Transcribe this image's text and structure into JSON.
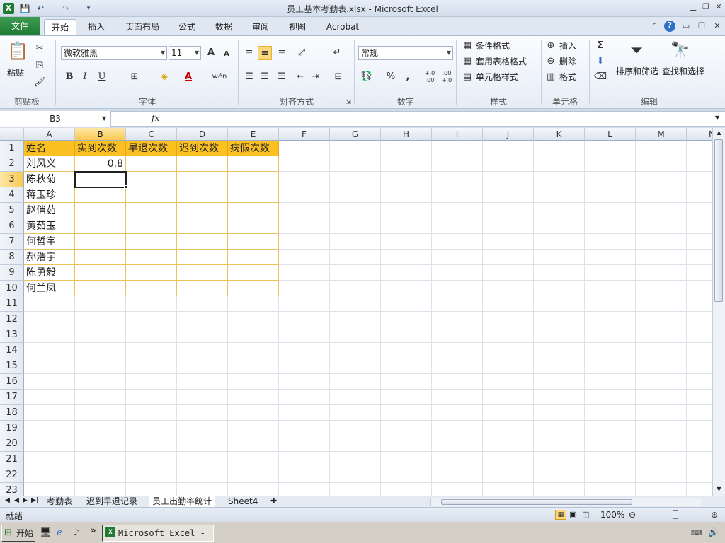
{
  "window": {
    "title": "员工基本考勤表.xlsx  -  Microsoft Excel",
    "app_icon": "X",
    "quick_access": [
      "save-icon",
      "undo-icon",
      "redo-icon",
      "customize-icon"
    ]
  },
  "tabs": {
    "file": "文件",
    "items": [
      "开始",
      "插入",
      "页面布局",
      "公式",
      "数据",
      "审阅",
      "视图",
      "Acrobat"
    ],
    "active": "开始"
  },
  "ribbon": {
    "clipboard": {
      "label": "剪贴板",
      "paste": "粘贴"
    },
    "font": {
      "label": "字体",
      "family": "微软雅黑",
      "size": "11",
      "bold": "B",
      "italic": "I",
      "underline": "U",
      "grow": "A",
      "shrink": "A",
      "font_color_letter": "A",
      "wen": "wén"
    },
    "align": {
      "label": "对齐方式"
    },
    "number": {
      "label": "数字",
      "format": "常规",
      "percent": "%",
      "comma": ",",
      "inc": "+.0 .00",
      "dec": ".00 +.0"
    },
    "styles": {
      "label": "样式",
      "cond": "条件格式",
      "table": "套用表格格式",
      "cell": "单元格样式"
    },
    "cells": {
      "label": "单元格",
      "insert": "插入",
      "delete": "删除",
      "format": "格式"
    },
    "editing": {
      "label": "编辑",
      "sigma": "Σ",
      "sort": "排序和筛选",
      "find": "查找和选择"
    }
  },
  "formula_bar": {
    "name_box": "B3",
    "fx": "fx",
    "value": ""
  },
  "sheet": {
    "columns": [
      "A",
      "B",
      "C",
      "D",
      "E",
      "F",
      "G",
      "H",
      "I",
      "J",
      "K",
      "L",
      "M",
      "N"
    ],
    "selected_col": "B",
    "selected_row": 3,
    "rows": [
      "1",
      "2",
      "3",
      "4",
      "5",
      "6",
      "7",
      "8",
      "9",
      "10",
      "11",
      "12",
      "13",
      "14",
      "15",
      "16",
      "17",
      "18",
      "19",
      "20",
      "21",
      "22",
      "23"
    ],
    "header": [
      "姓名",
      "实到次数",
      "早退次数",
      "迟到次数",
      "病假次数"
    ],
    "names": [
      "刘风义",
      "陈秋菊",
      "蒋玉珍",
      "赵俏茹",
      "黄茹玉",
      "何哲宇",
      "郝浩宇",
      "陈勇毅",
      "何兰凤"
    ],
    "b2": "0.8"
  },
  "sheet_tabs": {
    "items": [
      "考勤表",
      "迟到早退记录",
      "员工出勤率统计",
      "Sheet4"
    ],
    "active": "员工出勤率统计"
  },
  "status": {
    "ready": "就绪",
    "zoom": "100%"
  },
  "taskbar": {
    "start": "开始",
    "task": "Microsoft Excel - ..."
  },
  "colors": {
    "header_fill": "#fbc021",
    "selection_highlight": "#f9c94f",
    "file_tab": "#1f7a34"
  }
}
